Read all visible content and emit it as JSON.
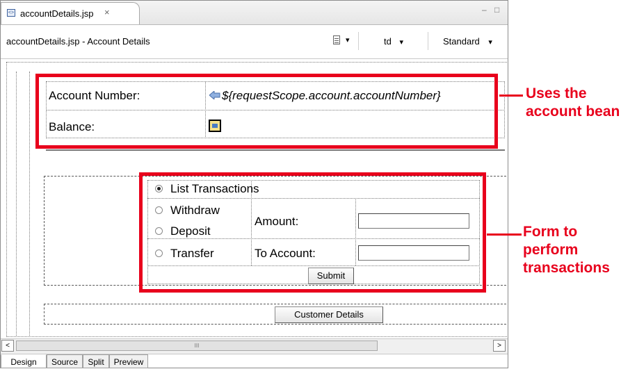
{
  "tab": {
    "title": "accountDetails.jsp",
    "close_glyph": "×",
    "file_icon": "jsp-file-icon"
  },
  "window_controls": {
    "minimize": "–",
    "maximize": "□"
  },
  "header": {
    "path": "accountDetails.jsp - Account Details",
    "page_menu_icon": "page-icon",
    "tag_selector": "td",
    "mode_selector": "Standard",
    "dropdown_glyph": "▾"
  },
  "account_table": {
    "account_number_label": "Account Number:",
    "account_number_value": "${requestScope.account.accountNumber}",
    "balance_label": "Balance:"
  },
  "transaction_form": {
    "options": [
      {
        "label": "List Transactions",
        "checked": true
      },
      {
        "label": "Withdraw",
        "checked": false
      },
      {
        "label": "Deposit",
        "checked": false
      },
      {
        "label": "Transfer",
        "checked": false
      }
    ],
    "amount_label": "Amount:",
    "to_account_label": "To Account:",
    "submit_label": "Submit"
  },
  "customer_details_button": "Customer Details",
  "scrollbar": {
    "left_arrow": "<",
    "right_arrow": ">",
    "thumb_grip": "III"
  },
  "page_tabs": [
    "Design",
    "Source",
    "Split",
    "Preview"
  ],
  "active_page_tab": "Design",
  "annotations": {
    "bean_callout": "Uses the account bean",
    "form_callout": "Form to perform transactions"
  },
  "colors": {
    "annotation_red": "#e8001c"
  }
}
